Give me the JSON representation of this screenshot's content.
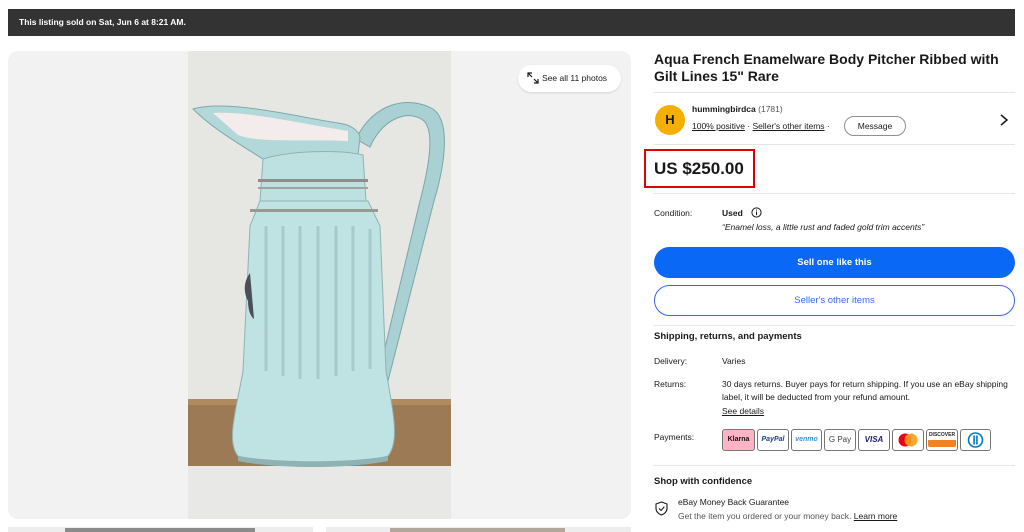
{
  "banner": {
    "text": "This listing sold on Sat, Jun 6 at 8:21 AM."
  },
  "gallery": {
    "see_all": "See all 11 photos",
    "image_subject": "aqua enamel pitcher photo"
  },
  "listing": {
    "title": "Aqua French Enamelware Body Pitcher Ribbed with Gilt Lines 15\" Rare",
    "price": "US $250.00"
  },
  "seller": {
    "avatar_letter": "H",
    "name": "hummingbirdca",
    "feedback_count": "(1781)",
    "positive": "100% positive",
    "sep": "·",
    "other_items": "Seller's other items",
    "message": "Message"
  },
  "condition": {
    "label": "Condition:",
    "value": "Used",
    "note": "“Enamel loss, a little rust and faded gold trim accents”"
  },
  "actions": {
    "sell_one": "Sell one like this",
    "other_items": "Seller's other items"
  },
  "shipping": {
    "title": "Shipping, returns, and payments",
    "delivery_label": "Delivery:",
    "delivery_value": "Varies",
    "returns_label": "Returns:",
    "returns_value": "30 days returns. Buyer pays for return shipping. If you use an eBay shipping label, it will be deducted from your refund amount.",
    "see_details": "See details",
    "payments_label": "Payments:",
    "payments": [
      "Klarna",
      "PayPal",
      "venmo",
      "G Pay",
      "VISA",
      "mastercard",
      "DISCOVER",
      "diners"
    ]
  },
  "confidence": {
    "title": "Shop with confidence",
    "guarantee": "eBay Money Back Guarantee",
    "guarantee_sub": "Get the item you ordered or your money back.",
    "learn_more": "Learn more"
  },
  "colors": {
    "accent": "#0968f6",
    "highlight": "#e00000",
    "avatar": "#f5af02",
    "banner": "#333333"
  }
}
